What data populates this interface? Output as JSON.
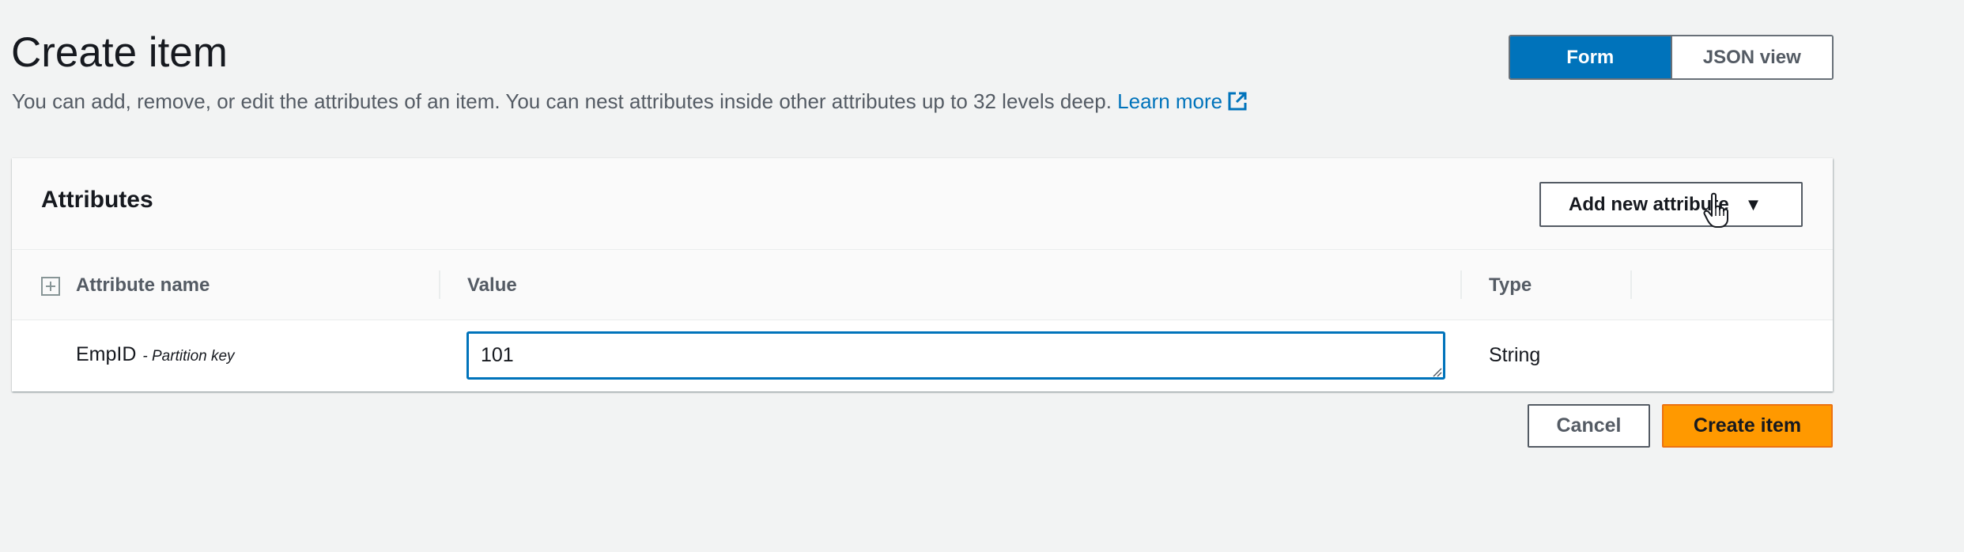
{
  "header": {
    "title": "Create item",
    "description": "You can add, remove, or edit the attributes of an item. You can nest attributes inside other attributes up to 32 levels deep.",
    "learn_more": "Learn more",
    "learn_more_icon": "external-link-icon"
  },
  "view_toggle": {
    "form_label": "Form",
    "json_label": "JSON view",
    "selected": "Form"
  },
  "attributes_panel": {
    "title": "Attributes",
    "add_button_label": "Add new attribute",
    "columns": {
      "name": "Attribute name",
      "value": "Value",
      "type": "Type"
    },
    "rows": [
      {
        "name": "EmpID",
        "key_label": "- Partition key",
        "value": "101",
        "type": "String"
      }
    ]
  },
  "actions": {
    "cancel_label": "Cancel",
    "create_label": "Create item"
  },
  "colors": {
    "primary_blue": "#0073bb",
    "create_orange": "#ff9900",
    "background": "#f2f3f3"
  }
}
